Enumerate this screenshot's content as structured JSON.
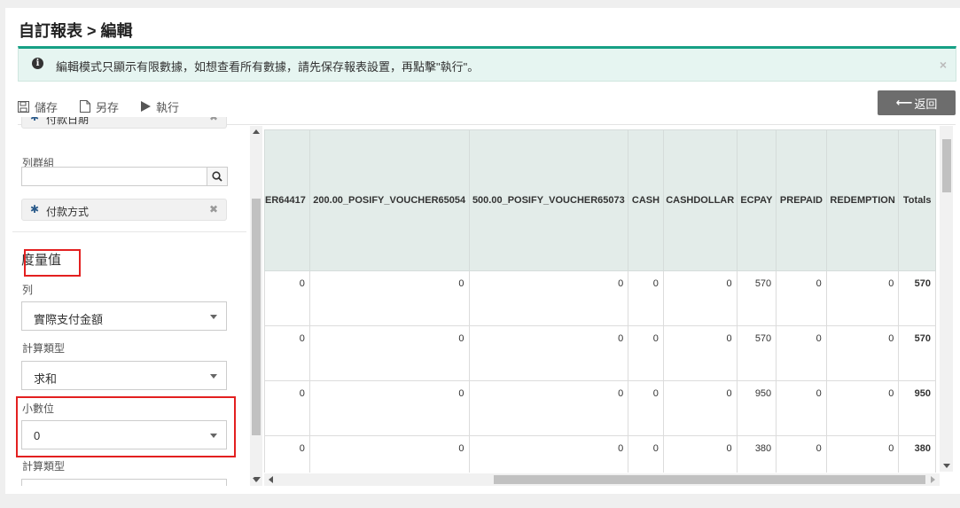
{
  "page": {
    "title": "自訂報表 > 編輯"
  },
  "alert": {
    "message": "編輯模式只顯示有限數據，如想查看所有數據，請先保存報表設置，再點擊\"執行\"。",
    "close": "×"
  },
  "toolbar": {
    "save": "儲存",
    "save_as": "另存",
    "run": "執行",
    "back": "返回"
  },
  "sidebar": {
    "partial_tag": "付款日期",
    "row_group_label": "列群組",
    "row_group_tag": "付款方式",
    "measure_title": "度量值",
    "column_label": "列",
    "column_value": "實際支付金額",
    "calc_type_label": "計算類型",
    "calc_type_value": "求和",
    "decimal_label": "小數位",
    "decimal_value": "0",
    "calc_type_label2": "計算類型"
  },
  "table": {
    "headers": [
      "ER64417",
      "200.00_POSIFY_VOUCHER65054",
      "500.00_POSIFY_VOUCHER65073",
      "CASH",
      "CASHDOLLAR",
      "ECPAY",
      "PREPAID",
      "REDEMPTION",
      "Totals"
    ],
    "rows": [
      [
        "0",
        "0",
        "0",
        "0",
        "0",
        "570",
        "0",
        "0",
        "570"
      ],
      [
        "0",
        "0",
        "0",
        "0",
        "0",
        "570",
        "0",
        "0",
        "570"
      ],
      [
        "0",
        "0",
        "0",
        "0",
        "0",
        "950",
        "0",
        "0",
        "950"
      ],
      [
        "0",
        "0",
        "0",
        "0",
        "0",
        "380",
        "0",
        "0",
        "380"
      ]
    ]
  },
  "icons": {
    "save": "floppy-icon",
    "save_as": "file-icon",
    "run": "play-icon",
    "search": "search-icon",
    "tag": "cog-icon",
    "info": "info-icon"
  }
}
